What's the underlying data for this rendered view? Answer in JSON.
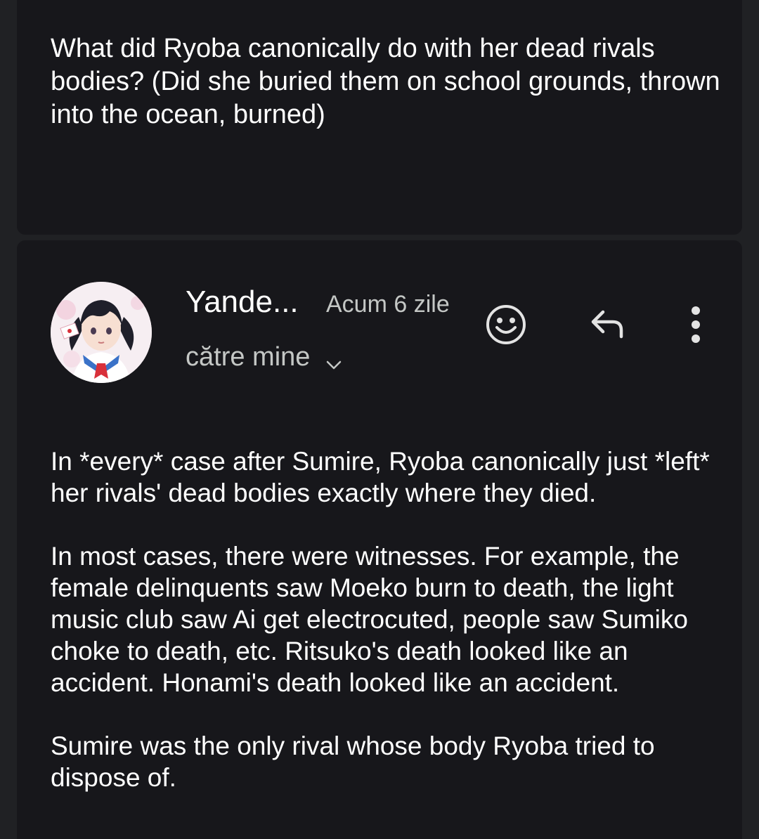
{
  "question": {
    "text": "What did Ryoba canonically do with her dead rivals bodies? (Did she buried them on school grounds, thrown into the ocean, burned)"
  },
  "reply": {
    "sender_name": "Yande...",
    "time": "Acum 6 zile",
    "recipient": "către mine",
    "avatar_icon": "anime-girl-avatar",
    "actions": {
      "emoji_icon": "smiley-icon",
      "reply_icon": "reply-arrow-icon",
      "more_icon": "vertical-dots-icon"
    },
    "body": [
      "In *every* case after Sumire, Ryoba canonically just *left* her rivals' dead bodies exactly where they died.",
      "In most cases, there were witnesses. For example, the female delinquents saw Moeko burn to death, the light music club saw Ai get electrocuted, people saw Sumiko choke to death, etc. Ritsuko's death looked like an accident. Honami's death looked like an accident.",
      "Sumire was the only rival whose body Ryoba tried to dispose of."
    ]
  },
  "colors": {
    "background": "#202124",
    "card": "#17171b",
    "text_primary": "#ffffff",
    "text_secondary": "#c4c7c5"
  }
}
